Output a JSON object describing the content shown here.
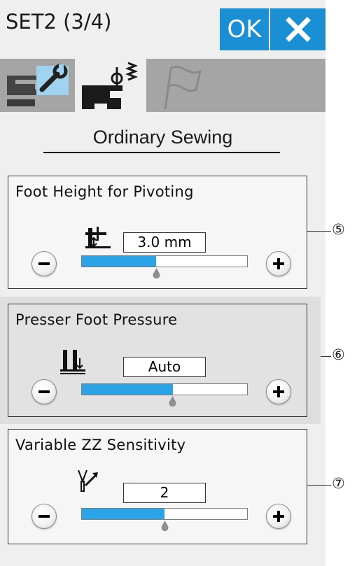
{
  "header": {
    "title": "SET2 (3/4)",
    "ok_label": "OK",
    "close_icon": "close-icon"
  },
  "tabs": [
    {
      "icon": "wrench-machine-icon",
      "active": false
    },
    {
      "icon": "sewing-machine-icon",
      "active": true
    },
    {
      "icon": "flag-icon",
      "active": false
    }
  ],
  "section": {
    "heading": "Ordinary Sewing"
  },
  "settings": [
    {
      "label": "Foot Height for Pivoting",
      "value": "3.0 mm",
      "level": 0.45,
      "icon": "foot-height-icon",
      "callout": "⑤"
    },
    {
      "label": "Presser Foot Pressure",
      "value": "Auto",
      "level": 0.55,
      "icon": "presser-foot-pressure-icon",
      "callout": "⑥"
    },
    {
      "label": "Variable ZZ Sensitivity",
      "value": "2",
      "level": 0.5,
      "icon": "zz-sensitivity-icon",
      "callout": "⑦"
    }
  ],
  "colors": {
    "accent": "#1b8fd3",
    "slider_fill": "#2aa4e6",
    "tab_bar": "#a5a5a5",
    "background": "#efefef"
  }
}
